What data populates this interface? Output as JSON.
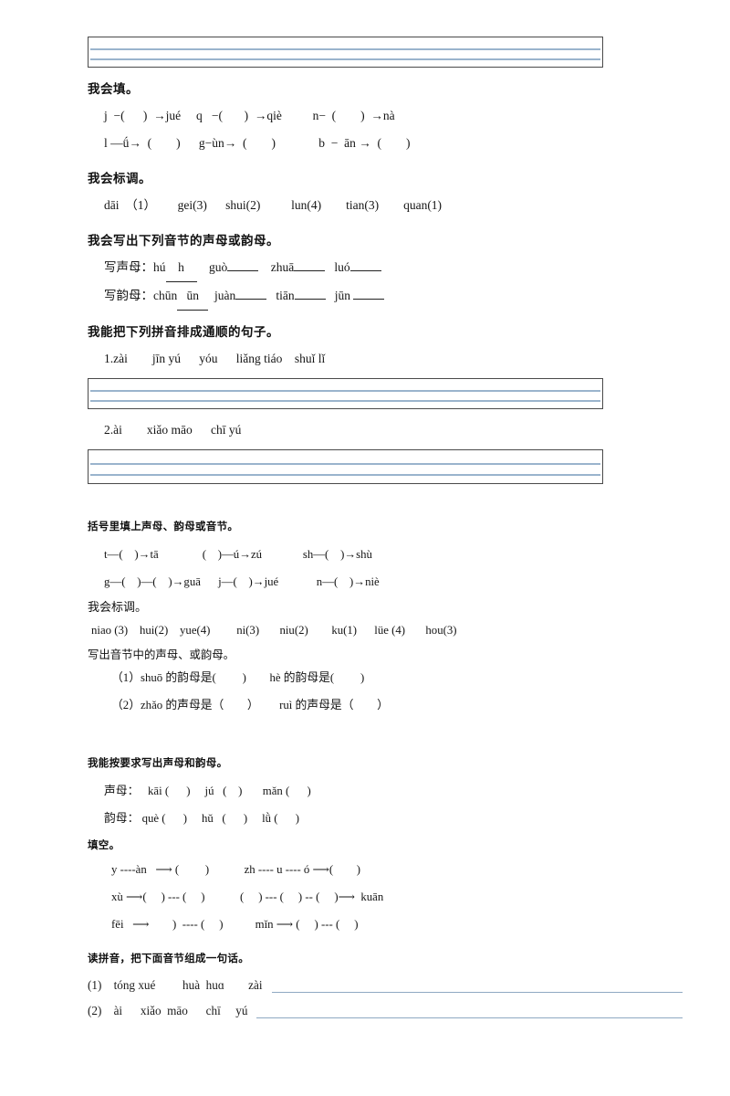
{
  "document": {
    "type": "pinyin-worksheet",
    "language": "zh-CN"
  },
  "section1": {
    "heading_fill": "我会填。",
    "fill_row1": "j  −(      )  →jué     q   −(       )  →qiè          n−  (        )  →nà",
    "fill_row2": "l —ǘ→  (        )      g−ùn→  (        )              b  −  ān →  (        )",
    "heading_tone": "我会标调。",
    "tone_items": [
      "dāi  （1）",
      "gei(3)",
      "shui(2)",
      "lun(4)",
      "tian(3)",
      "quan(1)"
    ],
    "tone_row": "dāi  （1）       gei(3)      shui(2)          lun(4)        tian(3)        quan(1)",
    "heading_initials_finals": "我会写出下列音节的声母或韵母。",
    "write_initial_label": "写声母：",
    "write_initial_items": [
      {
        "syllable": "hú",
        "answer": "h"
      },
      {
        "syllable": "guò",
        "answer": ""
      },
      {
        "syllable": "zhuā",
        "answer": ""
      },
      {
        "syllable": "luó",
        "answer": ""
      }
    ],
    "write_final_label": "写韵母：",
    "write_final_items": [
      {
        "syllable": "chūn",
        "answer": "ūn"
      },
      {
        "syllable": "juàn",
        "answer": ""
      },
      {
        "syllable": "tiān",
        "answer": ""
      },
      {
        "syllable": "jūn",
        "answer": ""
      }
    ],
    "heading_sentence": "我能把下列拼音排成通顺的句子。",
    "sentence1": "1.zài        jīn yú      yóu      liǎng tiáo    shuǐ lǐ",
    "sentence2": "2.ài        xiǎo māo      chī yú"
  },
  "section2": {
    "heading_brackets": "括号里填上声母、韵母或音节。",
    "bracket_row1": "t—(    )→tā               (    )—ú→zú              sh—(    )→shù",
    "bracket_row2": "g—(    )—(    )→guā      j—(    )→jué             n—(    )→niè",
    "heading_tone": "我会标调。",
    "tone_row": "niao (3)    hui(2)    yue(4)         ni(3)       niu(2)        ku(1)      lüe (4)       hou(3)",
    "tone_items": [
      "niao (3)",
      "hui(2)",
      "yue(4)",
      "ni(3)",
      "niu(2)",
      "ku(1)",
      "lüe (4)",
      "hou(3)"
    ],
    "heading_write": "写出音节中的声母、或韵母。",
    "q1": "（1）shuō 的韵母是(         )        hè 的韵母是(         )",
    "q2": "（2）zhǎo 的声母是（        ）       ruì 的声母是（        ）"
  },
  "section3": {
    "heading_request": "我能按要求写出声母和韵母。",
    "initials_label": "声母：",
    "initials_row": "声母：   kāi (      )     jú   (    )       mǎn (      )",
    "finals_label": "韵母：",
    "finals_row": "韵母： què (      )     hǔ   (      )     lǜ (      )",
    "heading_blank": "填空。",
    "blank_row1": "y ----àn   ⟶ (         )            zh ---- u ---- ó ⟶(        )",
    "blank_row2": "xù ⟶(     ) --- (     )            (     ) --- (     ) -- (     )⟶  kuān",
    "blank_row3": "fēi   ⟶        )  ---- (     )           mǐn ⟶ (     ) --- (     )"
  },
  "section4": {
    "heading": "读拼音，把下面音节组成一句话。",
    "rows": [
      {
        "num": "(1)",
        "pinyin": "tóng xué         huà  huɑ        zài"
      },
      {
        "num": "(2)",
        "pinyin": "ài      xiǎo  māo      chī     yú"
      }
    ]
  }
}
